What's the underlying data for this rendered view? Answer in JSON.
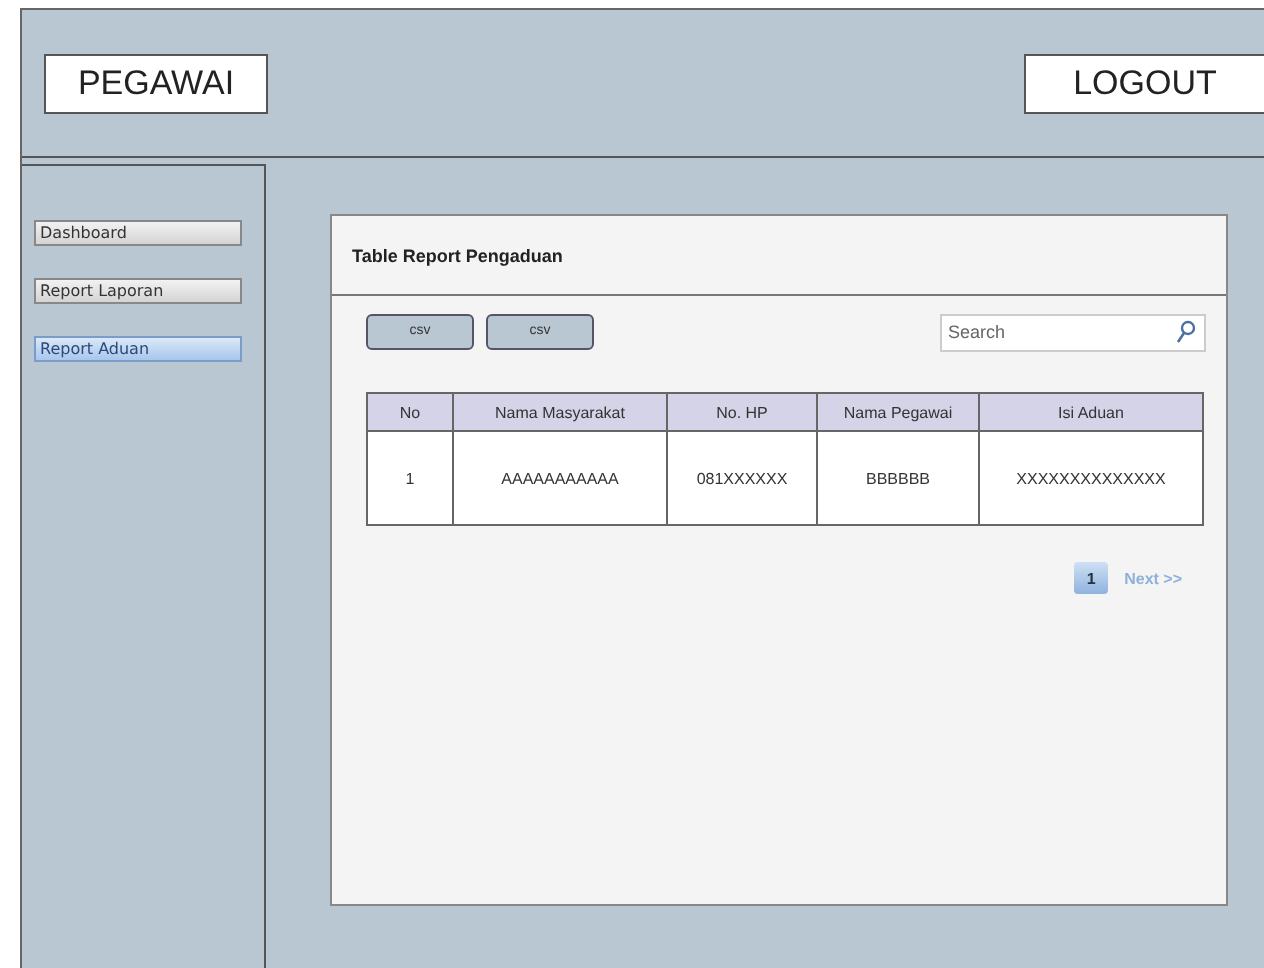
{
  "header": {
    "title": "PEGAWAI",
    "logout_button": "LOGOUT"
  },
  "sidebar": {
    "items": [
      {
        "label": "Dashboard",
        "selected": false
      },
      {
        "label": "Report Laporan",
        "selected": false
      },
      {
        "label": "Report Aduan",
        "selected": true
      }
    ]
  },
  "card": {
    "title": "Table Report Pengaduan",
    "export_buttons": [
      "csv",
      "csv"
    ],
    "search": {
      "placeholder": "Search"
    },
    "table": {
      "columns": [
        "No",
        "Nama Masyarakat",
        "No. HP",
        "Nama Pegawai",
        "Isi Aduan"
      ],
      "rows": [
        [
          "1",
          "AAAAAAAAAAA",
          "081XXXXXX",
          "BBBBBB",
          "XXXXXXXXXXXXXX"
        ]
      ]
    },
    "pagination": {
      "pages": [
        {
          "label": "1",
          "selected": true
        }
      ],
      "next": "Next >>"
    }
  }
}
